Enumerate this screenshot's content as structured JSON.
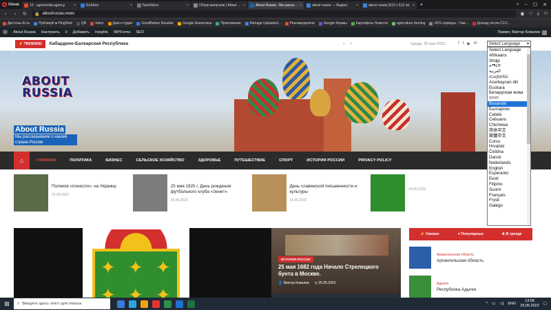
{
  "browser": {
    "menu_label": "Меню",
    "tabs": [
      {
        "label": "12 - agromedia.agency",
        "color": "#e34b2a"
      },
      {
        "label": "RuStore",
        "color": "#2f7de1"
      },
      {
        "label": "NashStore",
        "color": "#777777"
      },
      {
        "label": "Обзор выпусков | About Ru",
        "color": "#888888"
      },
      {
        "label": "About Russia - Мы расскаж",
        "color": "#1a63b8",
        "active": true
      },
      {
        "label": "about russia — Яндекс",
        "color": "#3c82e0"
      },
      {
        "label": "about russia (512 x 512 пи",
        "color": "#3c82e0"
      }
    ],
    "url": "aboutrussia.news",
    "bookmarks": [
      "Дистоны Есть",
      "Публикуй ►PingShot",
      "QR",
      "Inbox",
      "Дзен-студия",
      "GoodBarber Reseller",
      "Google Аналитика",
      "Приложения",
      "Manage Uploaded...",
      "Рекламодатели",
      "Google Формы",
      "Картофель Новости",
      "agriculture farming",
      "VDS серверы - Тим...",
      "Доклад посла ССС..."
    ]
  },
  "wp_admin": {
    "items": [
      "About Russia",
      "Настроить",
      "0",
      "Добавить",
      "Insights",
      "WPForms",
      "SEO"
    ],
    "greeting": "Привет, Виктор Ковалев"
  },
  "trending": {
    "badge": "TRENDING",
    "text": "Кабардино-Балкарская Республика",
    "date": "Среда, 25 мая 2022"
  },
  "language": {
    "selected": "Select Language",
    "options": [
      "Select Language",
      "Afrikaans",
      "Shqip",
      "አማርኛ",
      "العربية",
      "Հայերեն",
      "Azərbaycan dili",
      "Euskara",
      "Беларуская мова",
      "বাংলা",
      "Bosanski",
      "Български",
      "Català",
      "Cebuano",
      "Chichewa",
      "简体中文",
      "繁體中文",
      "Corsu",
      "Hrvatski",
      "Čeština",
      "Dansk",
      "Nederlands",
      "English",
      "Esperanto",
      "Eesti",
      "Filipino",
      "Suomi",
      "Français",
      "Frysk",
      "Galego"
    ],
    "highlighted_index": 10
  },
  "site": {
    "logo_line1": "ABOUT",
    "logo_line2": "RUSSIA",
    "title": "About Russia",
    "description": "Мы рассказываем о нашей стране России"
  },
  "nav": [
    "ГЛАВНАЯ",
    "ПОЛИТИКА",
    "БИЗНЕС",
    "СЕЛЬСКОЕ ХОЗЯЙСТВО",
    "ЗДОРОВЬЕ",
    "ПУТЕШЕСТВИЕ",
    "СПОРТ",
    "ИСТОРИЯ РОССИИ",
    "PRIVACY POLICY"
  ],
  "news_strip": [
    {
      "title": "Полеков «понесло», на Украину.",
      "date": "25.05.2022",
      "thumb": "#5a6b4a"
    },
    {
      "title": "25 мая 1925 г. День рождения футбольного клуба «Зенит».",
      "date": "25.05.2022",
      "thumb": "#7c7c7c"
    },
    {
      "title": "День славянской письменности и культуры",
      "date": "24.05.2022",
      "thumb": "#b8915a"
    },
    {
      "title": "",
      "date": "24.05.2022",
      "thumb": "#2f8f2f"
    }
  ],
  "featured_story": {
    "badge": "ИСТОРИЯ РОССИИ",
    "title": "25 мая 1682 года Начало Стрелецкого бунта в Москве.",
    "author": "Виктор Ковалев",
    "date": "25.05.2022"
  },
  "sidebar": {
    "tabs": [
      "Свежие",
      "Популярные",
      "В тренде"
    ],
    "items": [
      {
        "category": "Архангельская область",
        "title": "Архангельская область",
        "thumb": "#2d5fa8"
      },
      {
        "category": "Адыгея",
        "title": "Республика Адыгея",
        "thumb": "#3a8f3a"
      }
    ]
  },
  "taskbar": {
    "search_placeholder": "Введите здесь текст для поиска",
    "lang": "ENG",
    "time": "13:06",
    "date": "25.05.2022"
  }
}
